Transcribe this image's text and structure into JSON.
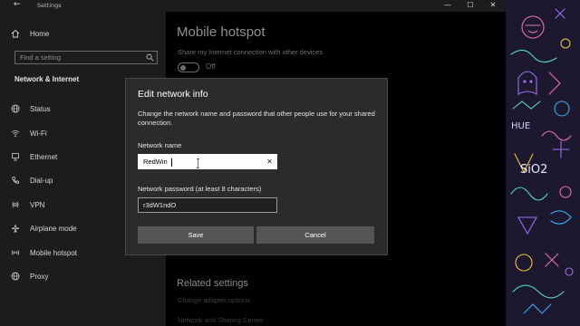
{
  "window": {
    "title": "Settings",
    "back_glyph": "←",
    "controls": {
      "minimize": "—",
      "maximize": "☐",
      "close": "✕"
    }
  },
  "sidebar": {
    "home_label": "Home",
    "search_placeholder": "Find a setting",
    "section_title": "Network & Internet",
    "items": [
      {
        "label": "Status",
        "icon": "globe-icon"
      },
      {
        "label": "Wi-Fi",
        "icon": "wifi-icon"
      },
      {
        "label": "Ethernet",
        "icon": "ethernet-icon"
      },
      {
        "label": "Dial-up",
        "icon": "phone-icon"
      },
      {
        "label": "VPN",
        "icon": "vpn-icon"
      },
      {
        "label": "Airplane mode",
        "icon": "airplane-icon"
      },
      {
        "label": "Mobile hotspot",
        "icon": "hotspot-icon"
      },
      {
        "label": "Proxy",
        "icon": "globe-icon"
      }
    ]
  },
  "main": {
    "page_title": "Mobile hotspot",
    "share_description": "Share my Internet connection with other devices",
    "toggle_state": "Off",
    "related_title": "Related settings",
    "related_links": [
      "Change adapter options",
      "Network and Sharing Center"
    ]
  },
  "dialog": {
    "title": "Edit network info",
    "description": "Change the network name and password that other people use for your shared connection.",
    "network_name_label": "Network name",
    "network_name_value": "RedWin",
    "password_label": "Network password (at least 8 characters)",
    "password_value": "r3dW1ndO",
    "save_label": "Save",
    "cancel_label": "Cancel",
    "clear_glyph": "✕"
  },
  "wallpaper": {
    "labels": [
      "HUE",
      "SiO2"
    ]
  },
  "colors": {
    "accent": "#ffffff",
    "sidebar_bg": "#1c1c1c",
    "dialog_bg": "#2b2b2b",
    "button_bg": "#555555"
  }
}
